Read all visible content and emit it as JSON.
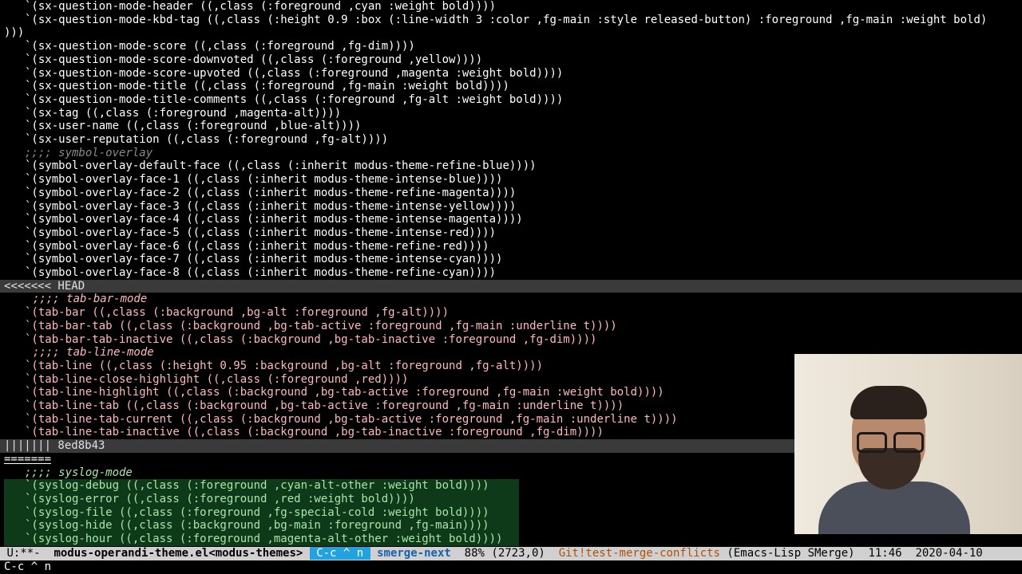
{
  "editor": {
    "lines": [
      {
        "text": "`(sx-question-mode-header ((,class (:foreground ,cyan :weight bold))))",
        "style": "normal"
      },
      {
        "text": "`(sx-question-mode-kbd-tag ((,class (:height 0.9 :box (:line-width 3 :color ,fg-main :style released-button) :foreground ,fg-main :weight bold)",
        "style": "normal"
      },
      {
        "text": ")))",
        "style": "wrap"
      },
      {
        "text": "`(sx-question-mode-score ((,class (:foreground ,fg-dim))))",
        "style": "normal"
      },
      {
        "text": "`(sx-question-mode-score-downvoted ((,class (:foreground ,yellow))))",
        "style": "normal"
      },
      {
        "text": "`(sx-question-mode-score-upvoted ((,class (:foreground ,magenta :weight bold))))",
        "style": "normal"
      },
      {
        "text": "`(sx-question-mode-title ((,class (:foreground ,fg-main :weight bold))))",
        "style": "normal"
      },
      {
        "text": "`(sx-question-mode-title-comments ((,class (:foreground ,fg-alt :weight bold))))",
        "style": "normal"
      },
      {
        "text": "`(sx-tag ((,class (:foreground ,magenta-alt))))",
        "style": "normal"
      },
      {
        "text": "`(sx-user-name ((,class (:foreground ,blue-alt))))",
        "style": "normal"
      },
      {
        "text": "`(sx-user-reputation ((,class (:foreground ,fg-alt))))",
        "style": "normal"
      },
      {
        "text": ";;;; symbol-overlay",
        "style": "comment"
      },
      {
        "text": "`(symbol-overlay-default-face ((,class (:inherit modus-theme-refine-blue))))",
        "style": "normal"
      },
      {
        "text": "`(symbol-overlay-face-1 ((,class (:inherit modus-theme-intense-blue))))",
        "style": "normal"
      },
      {
        "text": "`(symbol-overlay-face-2 ((,class (:inherit modus-theme-refine-magenta))))",
        "style": "normal"
      },
      {
        "text": "`(symbol-overlay-face-3 ((,class (:inherit modus-theme-intense-yellow))))",
        "style": "normal"
      },
      {
        "text": "`(symbol-overlay-face-4 ((,class (:inherit modus-theme-intense-magenta))))",
        "style": "normal"
      },
      {
        "text": "`(symbol-overlay-face-5 ((,class (:inherit modus-theme-intense-red))))",
        "style": "normal"
      },
      {
        "text": "`(symbol-overlay-face-6 ((,class (:inherit modus-theme-refine-red))))",
        "style": "normal"
      },
      {
        "text": "`(symbol-overlay-face-7 ((,class (:inherit modus-theme-intense-cyan))))",
        "style": "normal"
      },
      {
        "text": "`(symbol-overlay-face-8 ((,class (:inherit modus-theme-refine-cyan))))",
        "style": "normal"
      },
      {
        "text": "<<<<<<< HEAD",
        "style": "marker"
      },
      {
        "text": ";;;; tab-bar-mode",
        "style": "mine-comment"
      },
      {
        "text": "`(tab-bar ((,class (:background ,bg-alt :foreground ,fg-alt))))",
        "style": "mine"
      },
      {
        "text": "`(tab-bar-tab ((,class (:background ,bg-tab-active :foreground ,fg-main :underline t))))",
        "style": "mine"
      },
      {
        "text": "`(tab-bar-tab-inactive ((,class (:background ,bg-tab-inactive :foreground ,fg-dim))))",
        "style": "mine"
      },
      {
        "text": ";;;; tab-line-mode",
        "style": "mine-comment"
      },
      {
        "text": "`(tab-line ((,class (:height 0.95 :background ,bg-alt :foreground ,fg-alt))))",
        "style": "mine"
      },
      {
        "text": "`(tab-line-close-highlight ((,class (:foreground ,red))))",
        "style": "mine"
      },
      {
        "text": "`(tab-line-highlight ((,class (:background ,bg-tab-active :foreground ,fg-main :weight bold))))",
        "style": "mine"
      },
      {
        "text": "`(tab-line-tab ((,class (:background ,bg-tab-active :foreground ,fg-main :underline t))))",
        "style": "mine"
      },
      {
        "text": "`(tab-line-tab-current ((,class (:background ,bg-tab-active :foreground ,fg-main :underline t))))",
        "style": "mine"
      },
      {
        "text": "`(tab-line-tab-inactive ((,class (:background ,bg-tab-inactive :foreground ,fg-dim))))",
        "style": "mine"
      },
      {
        "text": "||||||| 8ed8b43",
        "style": "marker"
      },
      {
        "text": "=======",
        "style": "sep"
      },
      {
        "text": ";;;; syslog-mode",
        "style": "other-comment"
      },
      {
        "text": "`(syslog-debug ((,class (:foreground ,cyan-alt-other :weight bold))))",
        "style": "other"
      },
      {
        "text": "`(syslog-error ((,class (:foreground ,red :weight bold))))",
        "style": "other"
      },
      {
        "text": "`(syslog-file ((,class (:foreground ,fg-special-cold :weight bold))))",
        "style": "other"
      },
      {
        "text": "`(syslog-hide ((,class (:background ,bg-main :foreground ,fg-main))))",
        "style": "other"
      },
      {
        "text": "`(syslog-hour ((,class (:foreground ,magenta-alt-other :weight bold))))",
        "style": "other"
      }
    ]
  },
  "modeline": {
    "state": "U:**-",
    "buffer": "modus-operandi-theme.el<modus-themes>",
    "prefix_key": "C-c ^ n",
    "minor_mode": "smerge-next",
    "position": "88% (2723,0)",
    "vc": "Git!test-merge-conflicts",
    "modes": "(Emacs-Lisp SMerge)",
    "time": "11:46",
    "date": "2020-04-10"
  },
  "echo_area": {
    "text": "C-c ^ n"
  },
  "colors": {
    "background": "#000000",
    "modeline_bg": "#d0d0d0",
    "keyword": "#c8a0ff",
    "mine_fg": "#ffb9b9",
    "other_fg": "#a8e6a8",
    "prefix_key_bg": "#22a3e0"
  }
}
